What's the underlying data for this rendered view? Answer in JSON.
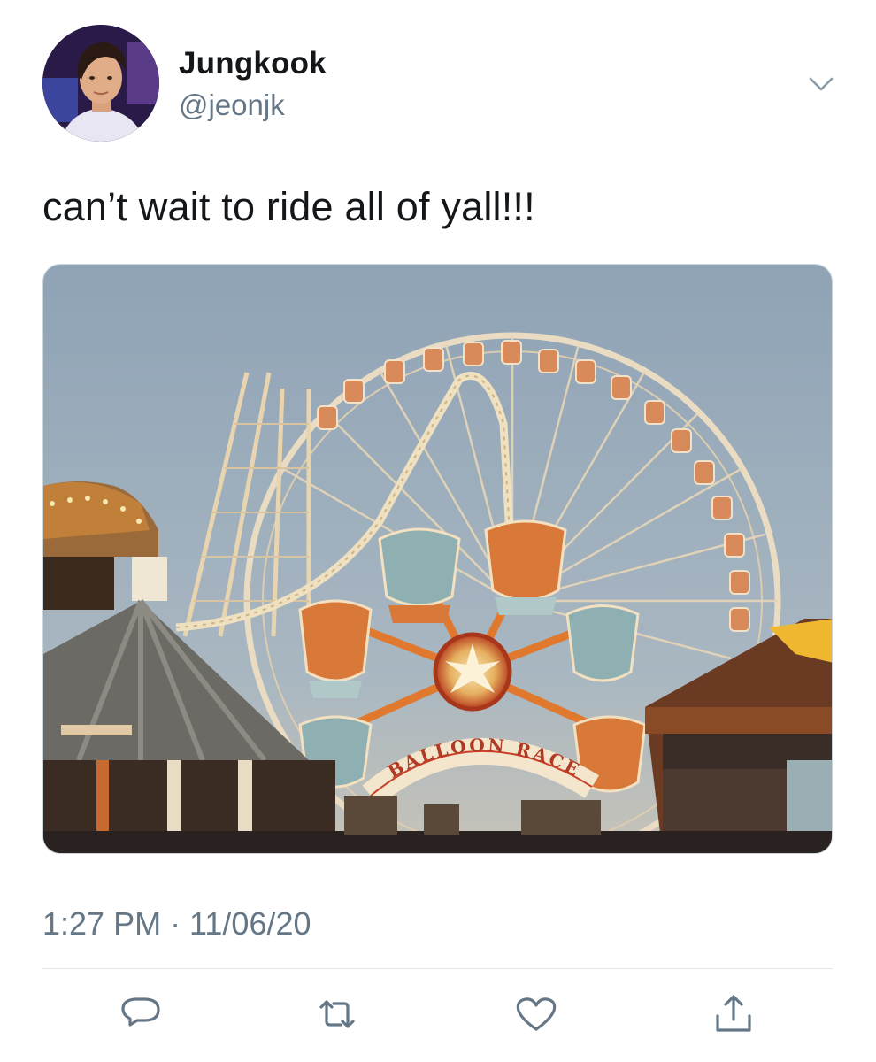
{
  "author": {
    "display_name": "Jungkook",
    "handle": "@jeonjk"
  },
  "tweet": {
    "text": "can’t wait to ride all of yall!!!",
    "timestamp": "1:27 PM · 11/06/20"
  },
  "media": {
    "sign_text": "BALLOON RACE"
  },
  "icons": {
    "caret": "chevron-down-icon",
    "reply": "reply-icon",
    "retweet": "retweet-icon",
    "like": "heart-icon",
    "share": "share-icon"
  },
  "colors": {
    "text_primary": "#14171a",
    "text_secondary": "#657786",
    "icon_gray": "#657786",
    "divider": "#e1e8ed"
  }
}
